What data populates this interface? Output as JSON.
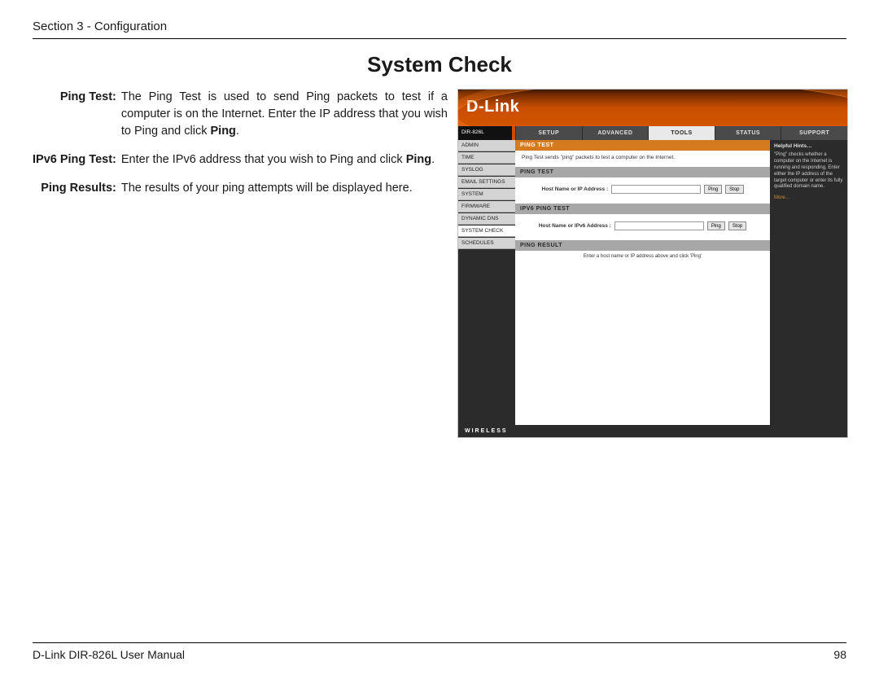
{
  "header": {
    "section_label": "Section 3 - Configuration"
  },
  "title": "System Check",
  "descriptions": [
    {
      "label": "Ping Test:",
      "body_pre": "The Ping Test is used to send Ping packets to test if a computer is on the Internet. Enter the IP address that you wish to Ping and click ",
      "bold": "Ping",
      "body_post": "."
    },
    {
      "label": "IPv6 Ping Test:",
      "body_pre": "Enter the IPv6 address that you wish to Ping and click ",
      "bold": "Ping",
      "body_post": "."
    },
    {
      "label": "Ping Results:",
      "body_pre": "The results of your ping attempts will be displayed here.",
      "bold": "",
      "body_post": ""
    }
  ],
  "router": {
    "logo": "D-Link",
    "model": "DIR-826L",
    "tabs": [
      "SETUP",
      "ADVANCED",
      "TOOLS",
      "STATUS",
      "SUPPORT"
    ],
    "active_tab": "TOOLS",
    "sidebar": [
      "ADMIN",
      "TIME",
      "SYSLOG",
      "EMAIL SETTINGS",
      "SYSTEM",
      "FIRMWARE",
      "DYNAMIC DNS",
      "SYSTEM CHECK",
      "SCHEDULES"
    ],
    "active_sidebar": "SYSTEM CHECK",
    "hints": {
      "title": "Helpful Hints…",
      "body": "\"Ping\" checks whether a computer on the Internet is running and responding. Enter either the IP address of the target computer or enter its fully qualified domain name.",
      "more": "More…"
    },
    "sections": {
      "ping_test_title": "PING TEST",
      "ping_test_intro": "Ping Test sends \"ping\" packets to test a computer on the Internet.",
      "ping_test_bar": "PING TEST",
      "ping_label": "Host Name or IP Address  :",
      "btn_ping": "Ping",
      "btn_stop": "Stop",
      "ipv6_bar": "IPV6 PING TEST",
      "ipv6_label": "Host Name or IPv6 Address  :",
      "result_bar": "PING RESULT",
      "result_text": "Enter a host name or IP address above and click 'Ping'"
    },
    "footer": "WIRELESS"
  },
  "footer": {
    "manual": "D-Link DIR-826L User Manual",
    "page": "98"
  }
}
